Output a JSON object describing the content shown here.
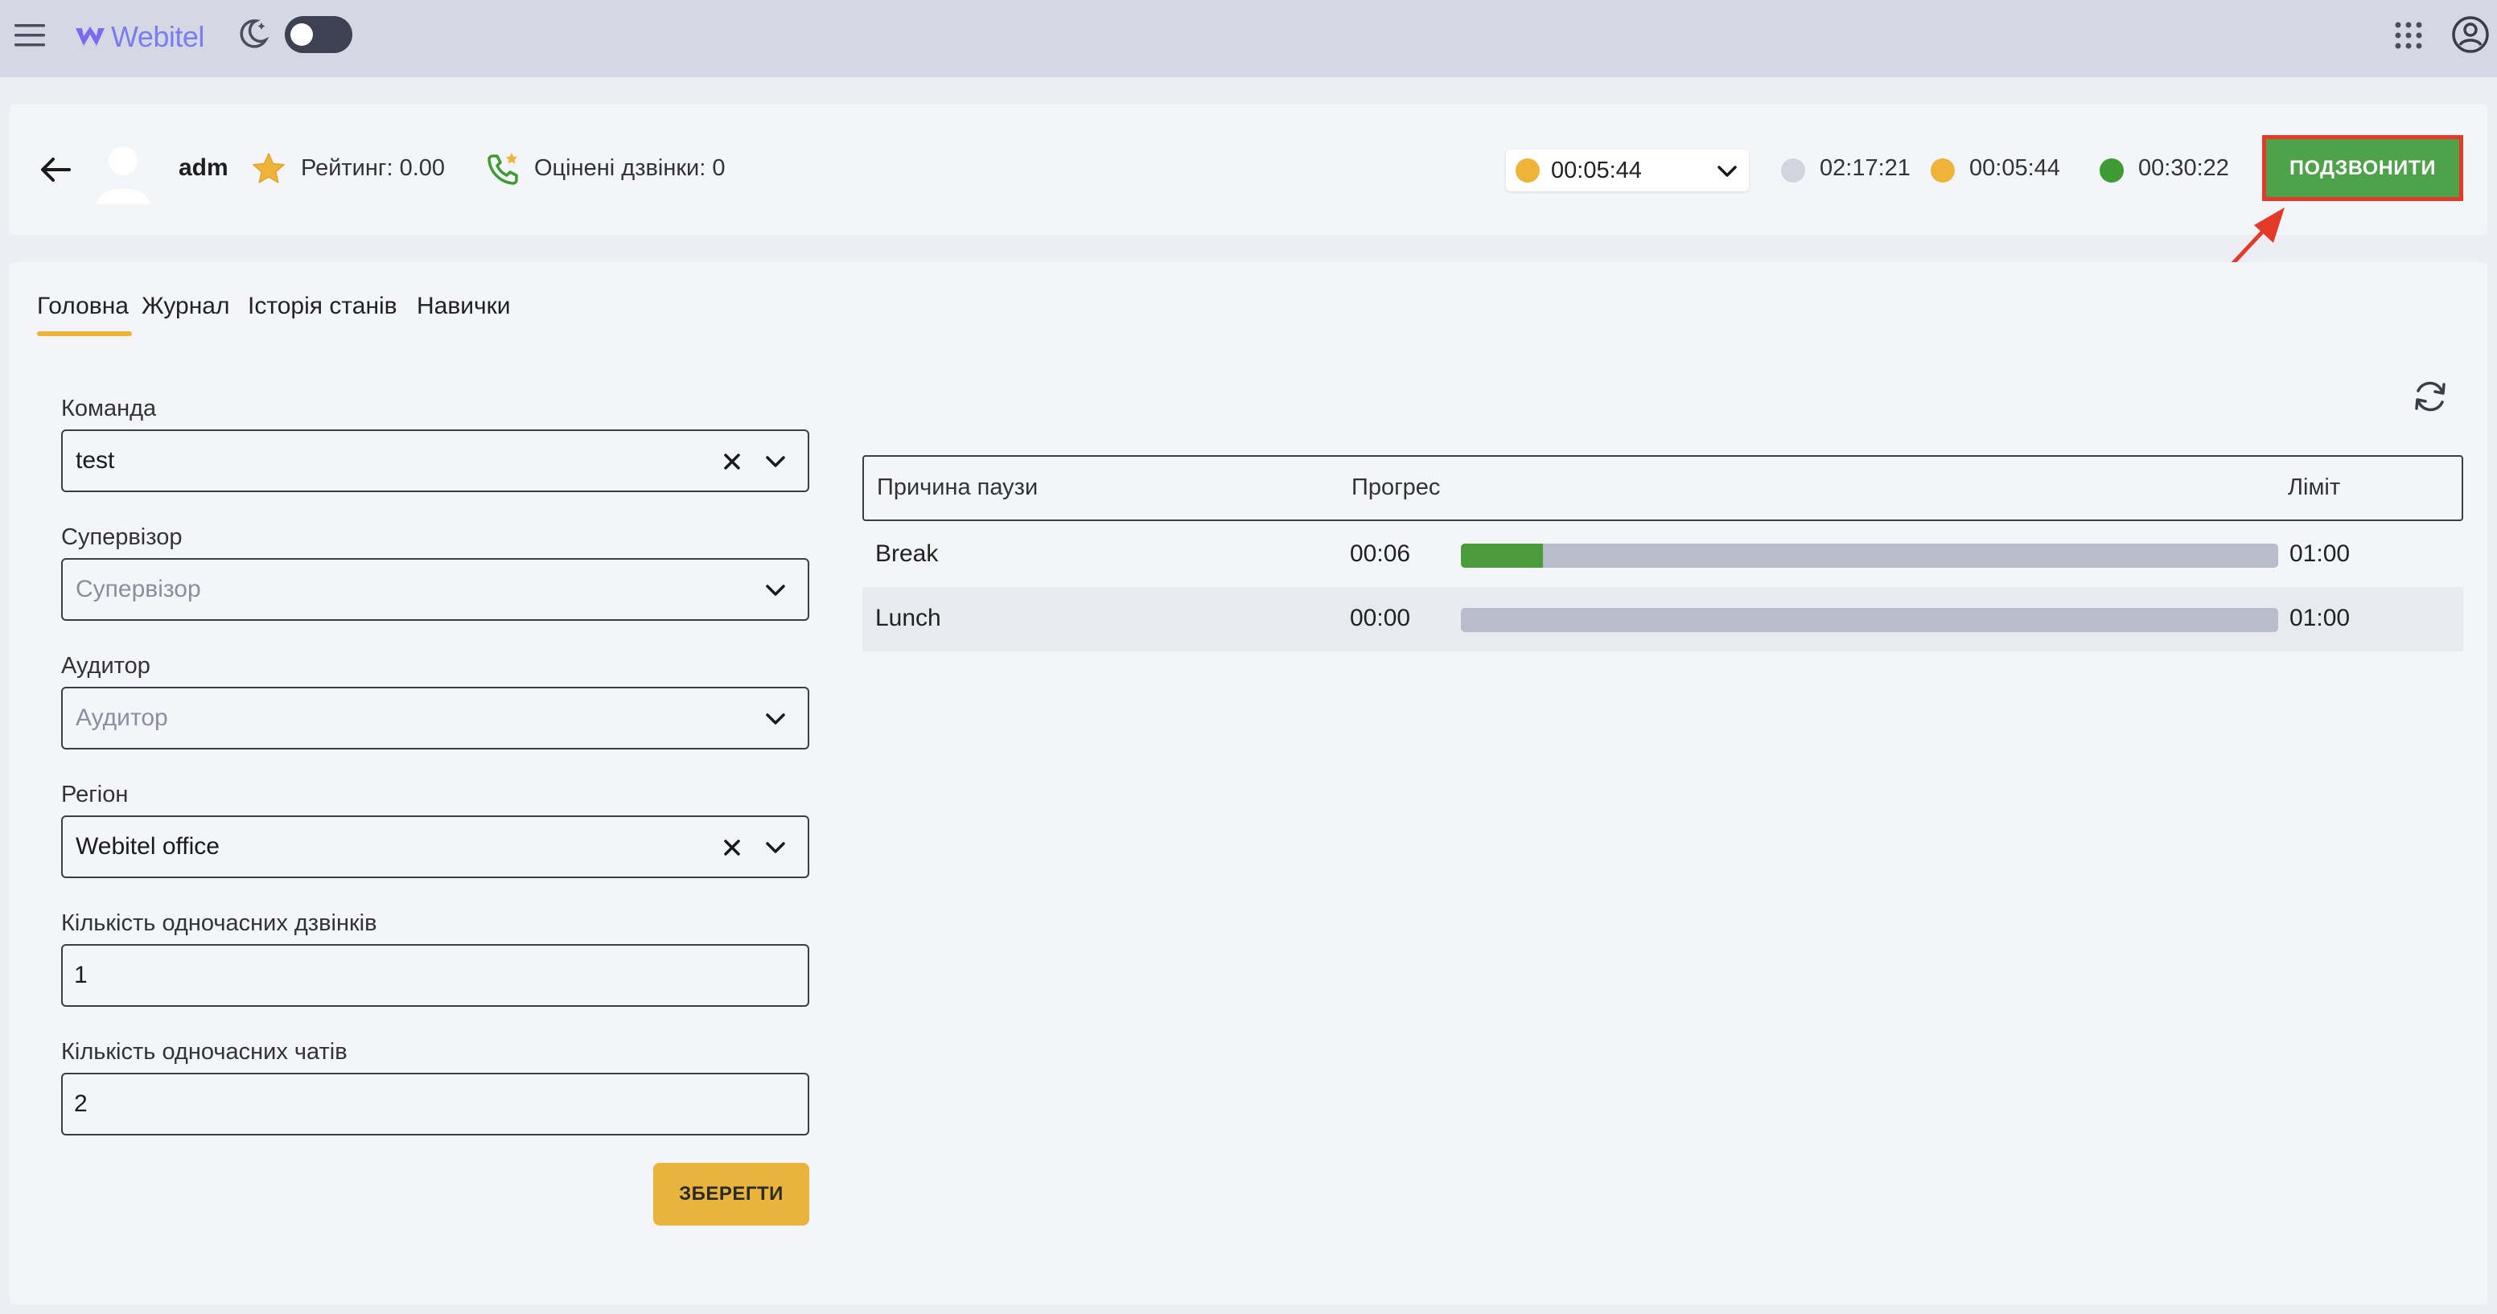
{
  "header": {
    "app_name": "Webitel",
    "theme_toggle_on": false
  },
  "agent": {
    "name": "adm",
    "rating": "Рейтинг: 0.00",
    "rated_calls": "Оцінені дзвінки: 0",
    "status": {
      "selected_color": "#f0b33a",
      "selected_time": "00:05:44"
    },
    "timers": [
      {
        "color": "#d3d5de",
        "time": "02:17:21"
      },
      {
        "color": "#f0b33a",
        "time": "00:05:44"
      },
      {
        "color": "#3e9a32",
        "time": "00:30:22"
      }
    ],
    "call_button": "ПОДЗВОНИТИ"
  },
  "tabs": [
    {
      "label": "Головна",
      "active": true
    },
    {
      "label": "Журнал",
      "active": false
    },
    {
      "label": "Історія станів",
      "active": false
    },
    {
      "label": "Навички",
      "active": false
    }
  ],
  "form": {
    "team": {
      "label": "Команда",
      "value": "test"
    },
    "supervisor": {
      "label": "Супервізор",
      "placeholder": "Супервізор"
    },
    "auditor": {
      "label": "Аудитор",
      "placeholder": "Аудитор"
    },
    "region": {
      "label": "Регіон",
      "value": "Webitel office"
    },
    "concurrent_calls": {
      "label": "Кількість одночасних дзвінків",
      "value": "1"
    },
    "concurrent_chats": {
      "label": "Кількість одночасних чатів",
      "value": "2"
    },
    "save_label": "ЗБЕРЕГТИ"
  },
  "pause_table": {
    "headers": {
      "reason": "Причина паузи",
      "progress": "Прогрес",
      "limit": "Ліміт"
    },
    "rows": [
      {
        "reason": "Break",
        "used": "00:06",
        "limit": "01:00",
        "progress_fraction": 0.1
      },
      {
        "reason": "Lunch",
        "used": "00:00",
        "limit": "01:00",
        "progress_fraction": 0.0
      }
    ]
  },
  "colors": {
    "accent_yellow": "#f0b33a",
    "call_green": "#4ea24a",
    "highlight_red": "#e43a2a",
    "progress_green": "#4b9a3c"
  }
}
